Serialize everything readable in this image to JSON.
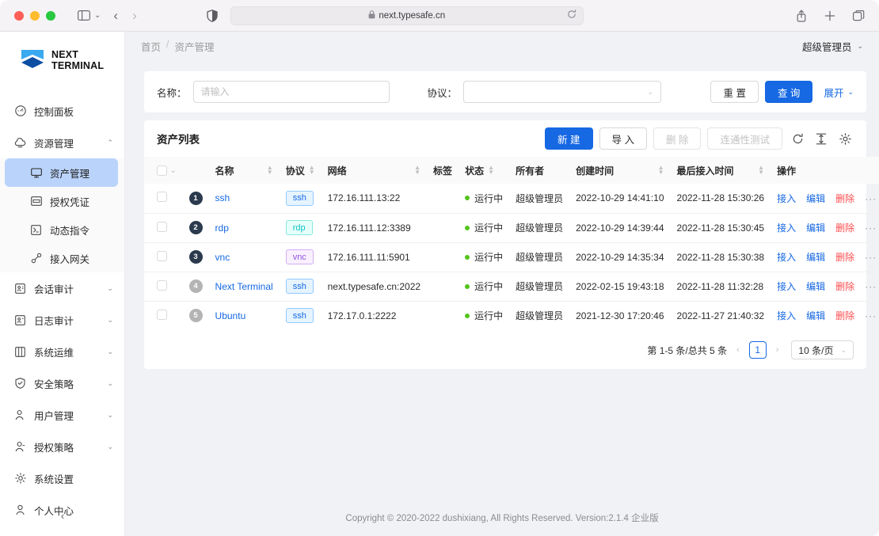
{
  "browser": {
    "url": "next.typesafe.cn",
    "lock_icon": "lock-icon",
    "shield_icon": "shield-icon",
    "reload_icon": "reload-icon",
    "back_icon": "back-arrow-icon",
    "forward_icon": "forward-arrow-icon",
    "sidebar_icon": "sidebar-toggle-icon",
    "share_icon": "share-icon",
    "new_tab_icon": "plus-icon",
    "tabs_icon": "tab-overview-icon"
  },
  "sidebar": {
    "logo": {
      "line1": "NEXT",
      "line2": "TERMINAL"
    },
    "items": [
      {
        "label": "控制面板",
        "icon": "dashboard-icon",
        "expandable": false
      },
      {
        "label": "资源管理",
        "icon": "cloud-icon",
        "expandable": true,
        "expanded": true,
        "children": [
          {
            "label": "资产管理",
            "icon": "monitor-icon",
            "active": true
          },
          {
            "label": "授权凭证",
            "icon": "credential-icon",
            "active": false
          },
          {
            "label": "动态指令",
            "icon": "command-icon",
            "active": false
          },
          {
            "label": "接入网关",
            "icon": "gateway-icon",
            "active": false
          }
        ]
      },
      {
        "label": "会话审计",
        "icon": "audit-icon",
        "expandable": true,
        "expanded": false
      },
      {
        "label": "日志审计",
        "icon": "log-icon",
        "expandable": true,
        "expanded": false
      },
      {
        "label": "系统运维",
        "icon": "ops-icon",
        "expandable": true,
        "expanded": false
      },
      {
        "label": "安全策略",
        "icon": "shield-icon",
        "expandable": true,
        "expanded": false
      },
      {
        "label": "用户管理",
        "icon": "user-icon",
        "expandable": true,
        "expanded": false
      },
      {
        "label": "授权策略",
        "icon": "user-key-icon",
        "expandable": true,
        "expanded": false
      },
      {
        "label": "系统设置",
        "icon": "gear-icon",
        "expandable": false
      },
      {
        "label": "个人中心",
        "icon": "person-icon",
        "expandable": false
      }
    ],
    "collapse_icon": "chevron-left-icon"
  },
  "header": {
    "breadcrumb": [
      "首页",
      "资产管理"
    ],
    "separator": "/",
    "user": "超级管理员",
    "user_caret": "chevron-down-icon"
  },
  "filter": {
    "name_label": "名称：",
    "name_placeholder": "请输入",
    "name_value": "",
    "protocol_label": "协议：",
    "protocol_value": "",
    "reset_label": "重 置",
    "search_label": "查 询",
    "expand_label": "展开",
    "expand_caret": "chevron-down-icon"
  },
  "toolbar": {
    "title": "资产列表",
    "new_label": "新 建",
    "import_label": "导 入",
    "delete_label": "删 除",
    "test_label": "连通性测试",
    "refresh_icon": "reload-icon",
    "density_icon": "column-height-icon",
    "settings_icon": "gear-icon"
  },
  "table": {
    "columns": [
      {
        "label": "",
        "sortable": false,
        "key": "check"
      },
      {
        "label": "名称",
        "sortable": true
      },
      {
        "label": "协议",
        "sortable": true
      },
      {
        "label": "网络",
        "sortable": true
      },
      {
        "label": "标签",
        "sortable": false
      },
      {
        "label": "状态",
        "sortable": true
      },
      {
        "label": "所有者",
        "sortable": false
      },
      {
        "label": "创建时间",
        "sortable": true
      },
      {
        "label": "最后接入时间",
        "sortable": true
      },
      {
        "label": "操作",
        "sortable": false
      }
    ],
    "rows": [
      {
        "num": "1",
        "num_color": "#2b3a4d",
        "name": "ssh",
        "protocol": "ssh",
        "protocol_class": "ssh",
        "network": "172.16.111.13:22",
        "tag": "",
        "status": "运行中",
        "owner": "超级管理员",
        "created": "2022-10-29 14:41:10",
        "last_access": "2022-11-28 15:30:26"
      },
      {
        "num": "2",
        "num_color": "#2b3a4d",
        "name": "rdp",
        "protocol": "rdp",
        "protocol_class": "rdp",
        "network": "172.16.111.12:3389",
        "tag": "",
        "status": "运行中",
        "owner": "超级管理员",
        "created": "2022-10-29 14:39:44",
        "last_access": "2022-11-28 15:30:45"
      },
      {
        "num": "3",
        "num_color": "#2b3a4d",
        "name": "vnc",
        "protocol": "vnc",
        "protocol_class": "vnc",
        "network": "172.16.111.11:5901",
        "tag": "",
        "status": "运行中",
        "owner": "超级管理员",
        "created": "2022-10-29 14:35:34",
        "last_access": "2022-11-28 15:30:38"
      },
      {
        "num": "4",
        "num_color": "#b4b4b4",
        "name": "Next Terminal",
        "protocol": "ssh",
        "protocol_class": "ssh",
        "network": "next.typesafe.cn:2022",
        "tag": "",
        "status": "运行中",
        "owner": "超级管理员",
        "created": "2022-02-15 19:43:18",
        "last_access": "2022-11-28 11:32:28"
      },
      {
        "num": "5",
        "num_color": "#b4b4b4",
        "name": "Ubuntu",
        "protocol": "ssh",
        "protocol_class": "ssh",
        "network": "172.17.0.1:2222",
        "tag": "",
        "status": "运行中",
        "owner": "超级管理员",
        "created": "2021-12-30 17:20:46",
        "last_access": "2022-11-27 21:40:32"
      }
    ],
    "actions": {
      "connect": "接入",
      "edit": "编辑",
      "delete": "删除",
      "more": "···"
    }
  },
  "pagination": {
    "summary": "第 1-5 条/总共 5 条",
    "prev_icon": "chevron-left-icon",
    "next_icon": "chevron-right-icon",
    "current_page": "1",
    "page_size": "10 条/页",
    "page_size_caret": "chevron-down-icon"
  },
  "footer": {
    "copyright": "Copyright © 2020-2022 dushixiang, All Rights Reserved. Version:2.1.4 企业版"
  },
  "colors": {
    "primary": "#1668e3",
    "danger": "#ff4d4f",
    "success": "#52c41a",
    "active_menu_bg": "#bad3fb"
  }
}
